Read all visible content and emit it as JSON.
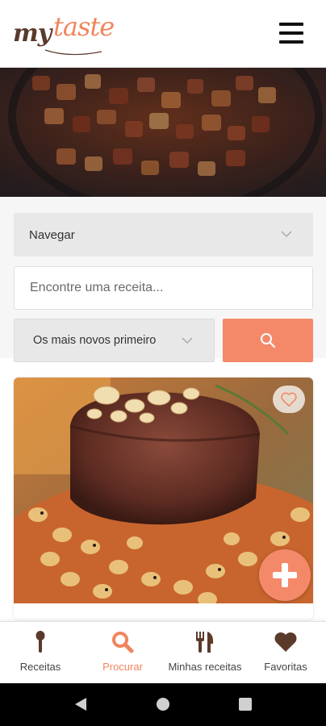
{
  "header": {
    "logo_my": "my",
    "logo_taste": "taste",
    "menu_icon": "hamburger-menu-icon"
  },
  "search": {
    "navigate_label": "Navegar",
    "query_placeholder": "Encontre uma receita...",
    "query_value": "",
    "sort_label": "Os mais novos primeiro",
    "search_icon": "search-icon"
  },
  "card": {
    "favorite_icon": "heart-outline-icon",
    "add_icon": "plus-icon"
  },
  "bottom_nav": {
    "items": [
      {
        "label": "Receitas",
        "icon": "spoon-icon",
        "active": false
      },
      {
        "label": "Procurar",
        "icon": "search-icon",
        "active": true
      },
      {
        "label": "Minhas receitas",
        "icon": "utensils-icon",
        "active": false
      },
      {
        "label": "Favoritas",
        "icon": "heart-icon",
        "active": false
      }
    ]
  },
  "system_nav": {
    "back_icon": "back-triangle-icon",
    "home_icon": "home-circle-icon",
    "recents_icon": "recents-square-icon"
  },
  "colors": {
    "accent": "#f4896a",
    "logo_brown": "#5a3a2a",
    "nav_text": "#444444"
  }
}
